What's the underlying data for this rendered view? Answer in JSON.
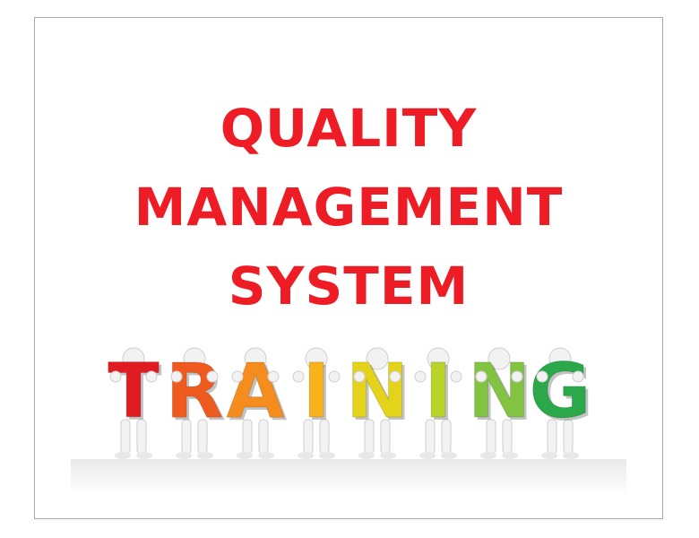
{
  "title": {
    "line1": "QUALITY",
    "line2": "MANAGEMENT",
    "line3": "SYSTEM"
  },
  "artwork": {
    "word": "TRAINING",
    "letters": [
      {
        "char": "T",
        "color": "#e11b22"
      },
      {
        "char": "R",
        "color": "#ef5a1f"
      },
      {
        "char": "A",
        "color": "#f58c1e"
      },
      {
        "char": "I",
        "color": "#f8b31c"
      },
      {
        "char": "N",
        "color": "#e3d31a"
      },
      {
        "char": "I",
        "color": "#b9d32a"
      },
      {
        "char": "N",
        "color": "#82c341"
      },
      {
        "char": "G",
        "color": "#2aa84a"
      }
    ]
  },
  "colors": {
    "title": "#ee1c25",
    "frame_border": "#a9a9a9",
    "figure": "#f2f2f2"
  }
}
